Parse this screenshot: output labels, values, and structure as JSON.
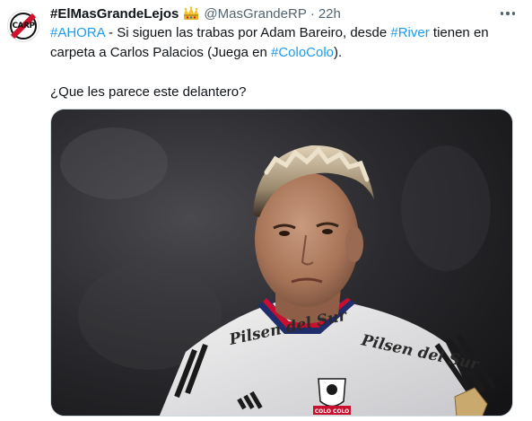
{
  "tweet": {
    "display_name": "#ElMasGrandeLejos",
    "badge_icon": "crown-icon",
    "handle": "@MasGrandeRP",
    "separator": "·",
    "time": "22h",
    "avatar_label": "CARP",
    "line1": {
      "tag1": "#AHORA",
      "t1": " - Si siguen las trabas por Adam Bareiro, desde ",
      "tag2": "#River",
      "t2": " tienen en"
    },
    "line2": {
      "t1": "carpeta a Carlos Palacios (Juega en ",
      "tag3": "#ColoColo",
      "t2": ")."
    },
    "line3": "¿Que les parece este delantero?",
    "media": {
      "jersey_text_left": "Pilsen del Sur",
      "jersey_text_right": "Pilsen del Sur",
      "badge_text": "COLO COLO",
      "kit_brand": "adidas"
    }
  },
  "colors": {
    "link": "#1d9bf0",
    "text": "#0f1419",
    "secondary": "#536471",
    "brand_red": "#d1122c"
  }
}
